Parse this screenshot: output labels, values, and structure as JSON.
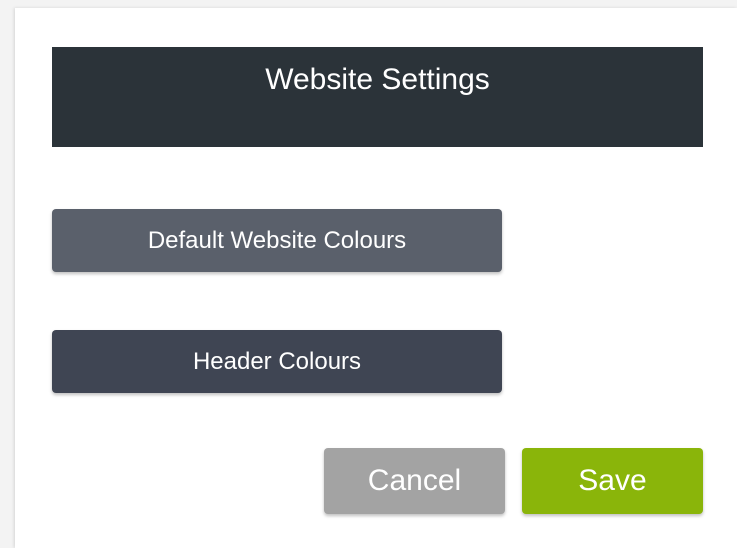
{
  "dialog": {
    "title": "Website Settings"
  },
  "menu": {
    "items": [
      {
        "label": "Default Website Colours"
      },
      {
        "label": "Header Colours"
      }
    ]
  },
  "actions": {
    "cancel_label": "Cancel",
    "save_label": "Save"
  },
  "colors": {
    "header_bar": "#2b3339",
    "default_colours_button": "#5a606b",
    "header_colours_button": "#3f4553",
    "cancel_button": "#a3a3a3",
    "save_button": "#8ab50a"
  }
}
